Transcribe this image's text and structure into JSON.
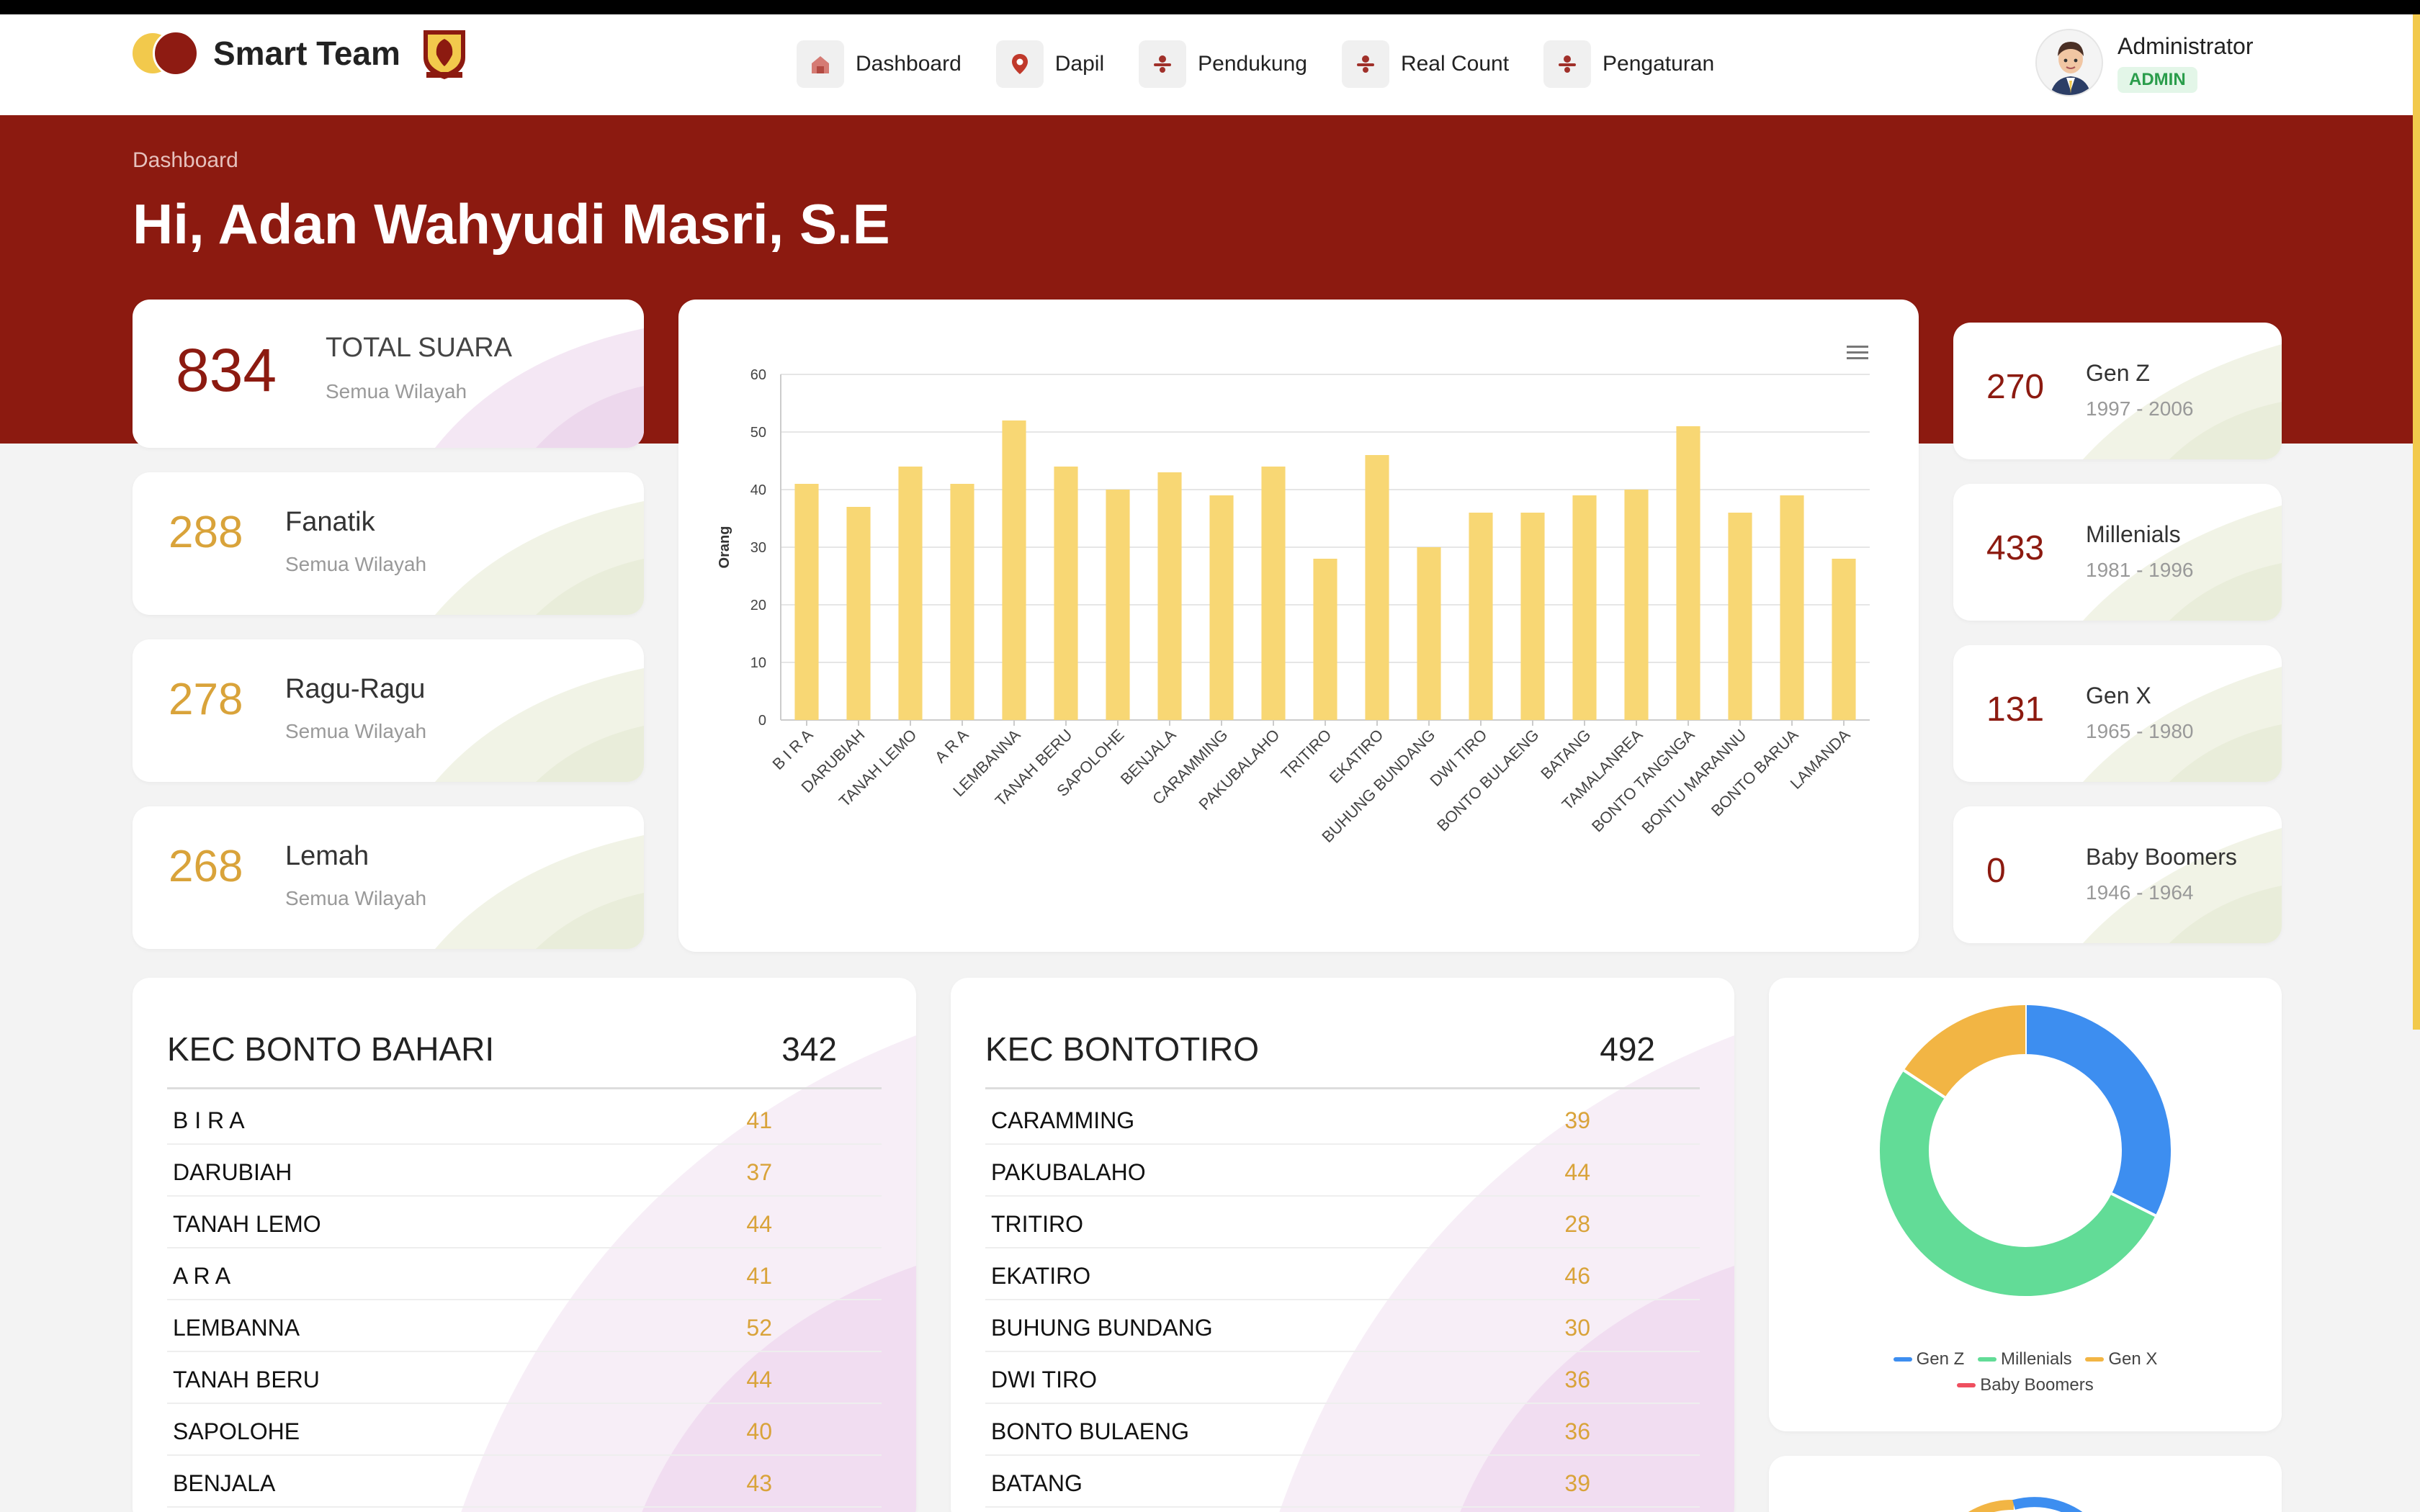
{
  "app": {
    "name": "Smart Team",
    "party_logo": "gerindra-logo"
  },
  "nav": [
    {
      "label": "Dashboard",
      "icon": "home-icon"
    },
    {
      "label": "Dapil",
      "icon": "map-pin-icon"
    },
    {
      "label": "Pendukung",
      "icon": "users-icon"
    },
    {
      "label": "Real Count",
      "icon": "users-icon"
    },
    {
      "label": "Pengaturan",
      "icon": "users-icon"
    }
  ],
  "user": {
    "name": "Administrator",
    "role": "ADMIN"
  },
  "header": {
    "breadcrumb": "Dashboard",
    "greeting": "Hi, Adan Wahyudi Masri, S.E"
  },
  "stats": {
    "total": {
      "value": "834",
      "label": "TOTAL SUARA",
      "sub": "Semua Wilayah"
    },
    "fanatik": {
      "value": "288",
      "label": "Fanatik",
      "sub": "Semua Wilayah"
    },
    "ragu": {
      "value": "278",
      "label": "Ragu-Ragu",
      "sub": "Semua Wilayah"
    },
    "lemah": {
      "value": "268",
      "label": "Lemah",
      "sub": "Semua Wilayah"
    }
  },
  "generations": [
    {
      "value": "270",
      "label": "Gen Z",
      "range": "1997 - 2006"
    },
    {
      "value": "433",
      "label": "Millenials",
      "range": "1981 - 1996"
    },
    {
      "value": "131",
      "label": "Gen X",
      "range": "1965 - 1980"
    },
    {
      "value": "0",
      "label": "Baby Boomers",
      "range": "1946 - 1964"
    }
  ],
  "colors": {
    "brand_red": "#8c1a10",
    "accent_gold": "#d9a33a",
    "bar_fill": "#f8d774"
  },
  "chart_data": [
    {
      "type": "bar",
      "ylabel": "Orang",
      "ylim": [
        0,
        60
      ],
      "yticks": [
        0,
        10,
        20,
        30,
        40,
        50,
        60
      ],
      "grid": true,
      "categories": [
        "B I R A",
        "DARUBIAH",
        "TANAH LEMO",
        "A R A",
        "LEMBANNA",
        "TANAH BERU",
        "SAPOLOHE",
        "BENJALA",
        "CARAMMING",
        "PAKUBALAHO",
        "TRITIRO",
        "EKATIRO",
        "BUHUNG BUNDANG",
        "DWI TIRO",
        "BONTO BULAENG",
        "BATANG",
        "TAMALANREA",
        "BONTO TANGNGA",
        "BONTU MARANNU",
        "BONTO BARUA",
        "LAMANDA"
      ],
      "values": [
        41,
        37,
        44,
        41,
        52,
        44,
        40,
        43,
        39,
        44,
        28,
        46,
        30,
        36,
        36,
        39,
        40,
        51,
        36,
        39,
        28
      ],
      "menu_icon": "hamburger-menu-icon"
    },
    {
      "type": "pie",
      "labels": [
        "Gen Z",
        "Millenials",
        "Gen X",
        "Baby Boomers"
      ],
      "values": [
        270,
        433,
        131,
        0
      ],
      "colors": [
        "#3d8ef0",
        "#62dc97",
        "#f2b544",
        "#ef4f5f"
      ],
      "legend": "bottom"
    }
  ],
  "kecamatan": [
    {
      "name": "KEC BONTO BAHARI",
      "total": "342",
      "rows": [
        {
          "name": "B I R A",
          "value": "41"
        },
        {
          "name": "DARUBIAH",
          "value": "37"
        },
        {
          "name": "TANAH LEMO",
          "value": "44"
        },
        {
          "name": "A R A",
          "value": "41"
        },
        {
          "name": "LEMBANNA",
          "value": "52"
        },
        {
          "name": "TANAH BERU",
          "value": "44"
        },
        {
          "name": "SAPOLOHE",
          "value": "40"
        },
        {
          "name": "BENJALA",
          "value": "43"
        }
      ]
    },
    {
      "name": "KEC BONTOTIRO",
      "total": "492",
      "rows": [
        {
          "name": "CARAMMING",
          "value": "39"
        },
        {
          "name": "PAKUBALAHO",
          "value": "44"
        },
        {
          "name": "TRITIRO",
          "value": "28"
        },
        {
          "name": "EKATIRO",
          "value": "46"
        },
        {
          "name": "BUHUNG BUNDANG",
          "value": "30"
        },
        {
          "name": "DWI TIRO",
          "value": "36"
        },
        {
          "name": "BONTO BULAENG",
          "value": "36"
        },
        {
          "name": "BATANG",
          "value": "39"
        }
      ]
    }
  ]
}
